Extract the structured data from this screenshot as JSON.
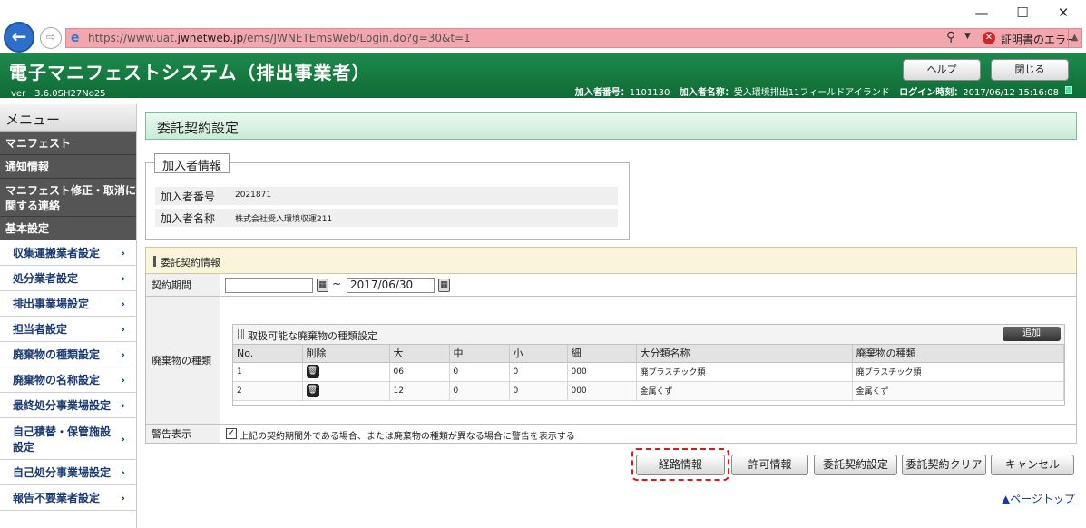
{
  "browser": {
    "url_prefix": "https://www.uat.",
    "url_domain": "jwnetweb.jp",
    "url_path": "/ems/JWNETEmsWeb/Login.do?g=30&t=1",
    "cert_error": "証明書のエラー",
    "window_min": "—",
    "window_max": "☐",
    "window_close": "✕"
  },
  "header": {
    "title": "電子マニフェストシステム（排出事業者）",
    "version": "ver　3.6.0SH27No25",
    "help_label": "ヘルプ",
    "close_label": "閉じる",
    "member_no_label": "加入者番号：",
    "member_no": "1101130",
    "member_name_label": "加入者名称：",
    "member_name": "受入環境排出11フィールドアイランド",
    "login_label": "ログイン時刻：",
    "login_time": "2017/06/12 15:16:08"
  },
  "sidebar": {
    "title": "メニュー",
    "items": [
      {
        "label": "マニフェスト",
        "type": "category",
        "h": 26
      },
      {
        "label": "通知情報",
        "type": "category",
        "h": 26
      },
      {
        "label": "マニフェスト修正・取消に関する連絡",
        "type": "category",
        "h": 42
      },
      {
        "label": "基本設定",
        "type": "category",
        "h": 26
      },
      {
        "label": "収集運搬業者設定",
        "type": "item",
        "h": 28
      },
      {
        "label": "処分業者設定",
        "type": "item",
        "h": 28
      },
      {
        "label": "排出事業場設定",
        "type": "item",
        "h": 28
      },
      {
        "label": "担当者設定",
        "type": "item",
        "h": 28
      },
      {
        "label": "廃棄物の種類設定",
        "type": "item",
        "h": 28
      },
      {
        "label": "廃棄物の名称設定",
        "type": "item",
        "h": 28
      },
      {
        "label": "最終処分事業場設定",
        "type": "item",
        "h": 28
      },
      {
        "label": "自己積替・保管施設設定",
        "type": "item",
        "h": 46
      },
      {
        "label": "自己処分事業場設定",
        "type": "item",
        "h": 28
      },
      {
        "label": "報告不要業者設定",
        "type": "item",
        "h": 28
      }
    ]
  },
  "page": {
    "title": "委託契約設定",
    "member_section": "加入者情報",
    "member_no_label": "加入者番号",
    "member_no_value": "2021871",
    "member_name_label": "加入者名称",
    "member_name_value": "株式会社受入環境収運211",
    "contract_section": "委託契約情報",
    "period_label": "契約期間",
    "period_from": "",
    "period_sep": "~",
    "period_to": "2017/06/30",
    "waste_label": "廃棄物の種類",
    "waste_panel_title": "取扱可能な廃棄物の種類設定",
    "add_label": "追加",
    "table_headers": [
      "No.",
      "削除",
      "大",
      "中",
      "小",
      "細",
      "大分類名称",
      "廃棄物の種類"
    ],
    "table_rows": [
      [
        "1",
        "06",
        "0",
        "0",
        "000",
        "廃プラスチック類",
        "廃プラスチック類"
      ],
      [
        "2",
        "12",
        "0",
        "0",
        "000",
        "金属くず",
        "金属くず"
      ]
    ],
    "warn_label": "警告表示",
    "warn_checked": "✓",
    "warn_text": "上記の契約期間外である場合、または廃棄物の種類が異なる場合に警告を表示する",
    "btn_route": "経路情報",
    "btn_permit": "許可情報",
    "btn_set": "委託契約設定",
    "btn_clear": "委託契約クリア",
    "btn_cancel": "キャンセル",
    "page_top": "▲ページトップ"
  }
}
